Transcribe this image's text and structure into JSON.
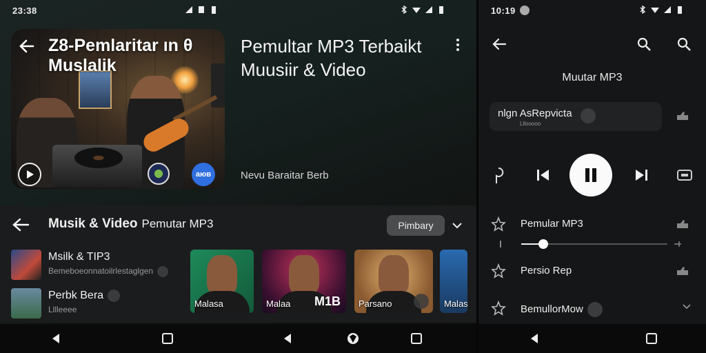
{
  "status_left": {
    "time": "23:38"
  },
  "status_right": {
    "time": "10:19"
  },
  "hero": {
    "title": "Z8-Pemlaritar ın θ Muslalik",
    "badge_text": "аюв"
  },
  "headline": {
    "line": "Pemultar MP3 Terbaikt Muusiir & Video"
  },
  "subline": "Nevu Baraitar Berb",
  "section": {
    "title": "Musik & Video",
    "subtitle": "Pemutar MP3",
    "chip_label": "Pimbary",
    "list": [
      {
        "title": "Msilk & TIP3",
        "subtitle": "Bemeboeonnatoilrlestaglgen"
      },
      {
        "title": "Perbk Bera",
        "subtitle": "Lllleeee"
      }
    ],
    "cards": [
      {
        "caption": "Malasa",
        "extra": ""
      },
      {
        "caption": "Malaa",
        "extra": "M1B"
      },
      {
        "caption": "Parsano",
        "extra": ""
      },
      {
        "caption": "Malas",
        "extra": ""
      }
    ]
  },
  "right_panel": {
    "title": "Muutar MP3",
    "now_playing": {
      "name": "nlgn AsRepvicta",
      "sub": "Lllooooo"
    },
    "rows": [
      {
        "label": "Pemular MP3"
      },
      {
        "label": "Persio Rep"
      },
      {
        "label": "BemullorMow"
      }
    ],
    "progress": 0.15
  },
  "icons": {
    "back": "arrow-left-icon",
    "search": "search-icon",
    "play": "play-icon",
    "pause": "pause-icon",
    "previous": "skip-previous-icon",
    "next": "skip-next-icon",
    "menu": "more-vert-icon",
    "nav_back": "triangle-back-icon",
    "nav_home": "home-icon",
    "nav_recent": "square-recent-icon"
  },
  "colors": {
    "accent_blue": "#2f6fe0",
    "chip_bg": "#4a4c4e",
    "panel_bg": "#151617"
  }
}
